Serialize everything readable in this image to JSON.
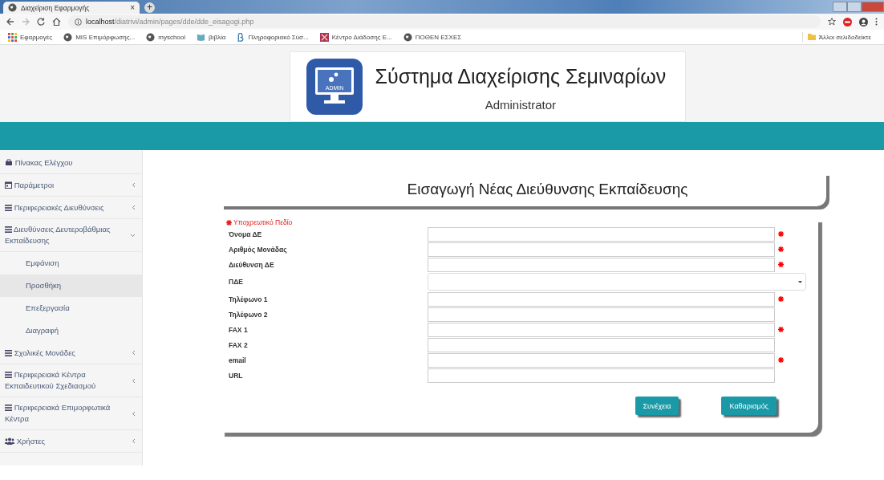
{
  "browser": {
    "tab_title": "Διαχείριση Εφαρμογής",
    "tab_close": "×",
    "new_tab": "+",
    "url_host": "localhost",
    "url_path": "/diatrivi/admin/pages/dde/dde_eisagogi.php",
    "bookmarks": [
      {
        "label": "Εφαρμογές"
      },
      {
        "label": "MIS Επιμόρφωσης..."
      },
      {
        "label": "myschool"
      },
      {
        "label": "βιβλία"
      },
      {
        "label": "Πληροφοριακό Σύσ..."
      },
      {
        "label": "Κέντρο Διάδοσης Ε..."
      },
      {
        "label": "ΠΟΘΕΝ ΕΣΧΕΣ"
      }
    ],
    "other_bookmarks": "Άλλοι σελιδοδείκτε"
  },
  "header": {
    "logo_label": "ADMIN",
    "title": "Σύστημα Διαχείρισης Σεμιναρίων",
    "subtitle": "Administrator"
  },
  "sidebar": {
    "items": [
      {
        "label": "Πίνακας Ελέγχου",
        "kind": "link"
      },
      {
        "label": "Παράμετροι",
        "kind": "menu",
        "expanded": false
      },
      {
        "label": "Περιφερειακές Διευθύνσεις",
        "kind": "menu",
        "expanded": false
      },
      {
        "label": "Διευθύνσεις Δευτεροβάθμιας Εκπαίδευσης",
        "kind": "menu",
        "expanded": true,
        "children": [
          {
            "label": "Εμφάνιση",
            "selected": false
          },
          {
            "label": "Προσθήκη",
            "selected": true
          },
          {
            "label": "Επεξεργασία",
            "selected": false
          },
          {
            "label": "Διαγραφή",
            "selected": false
          }
        ]
      },
      {
        "label": "Σχολικές Μονάδες",
        "kind": "menu",
        "expanded": false
      },
      {
        "label": "Περιφερειακά Κέντρα Εκπαιδευτικού Σχεδιασμού",
        "kind": "menu",
        "expanded": false
      },
      {
        "label": "Περιφερειακά Επιμορφωτικά Κέντρα",
        "kind": "menu",
        "expanded": false
      },
      {
        "label": "Χρήστες",
        "kind": "menu",
        "expanded": false
      }
    ]
  },
  "form": {
    "title": "Εισαγωγή Νέας Διεύθυνσης Εκπαίδευσης",
    "required_note": "Υποχρεωτικό Πεδίο",
    "fields": [
      {
        "label": "Όνομα ΔΕ",
        "kind": "text",
        "required": true
      },
      {
        "label": "Αριθμός Μονάδας",
        "kind": "text",
        "required": true
      },
      {
        "label": "Διεύθυνση ΔΕ",
        "kind": "text",
        "required": true
      },
      {
        "label": "ΠΔΕ",
        "kind": "select",
        "required": false
      },
      {
        "label": "Τηλέφωνο 1",
        "kind": "text",
        "required": true
      },
      {
        "label": "Τηλέφωνο 2",
        "kind": "text",
        "required": false
      },
      {
        "label": "FAX 1",
        "kind": "text",
        "required": true
      },
      {
        "label": "FAX 2",
        "kind": "text",
        "required": false
      },
      {
        "label": "email",
        "kind": "text",
        "required": true
      },
      {
        "label": "URL",
        "kind": "text",
        "required": false
      }
    ],
    "buttons": [
      "Συνέχεια",
      "Καθαρισμός"
    ]
  }
}
